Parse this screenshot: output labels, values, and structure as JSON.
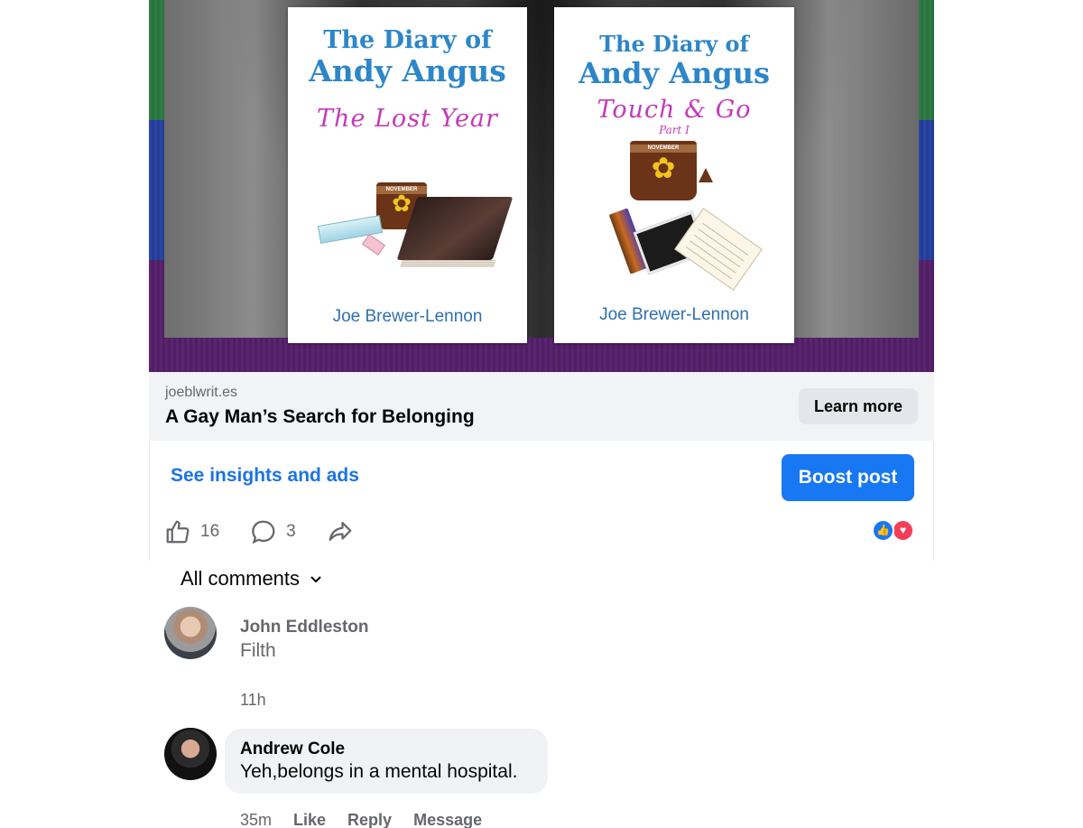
{
  "ad": {
    "books": [
      {
        "title_line1": "The Diary of",
        "title_line2": "Andy Angus",
        "subtitle": "The Lost Year",
        "part": "",
        "author": "Joe Brewer-Lennon"
      },
      {
        "title_line1": "The Diary of",
        "title_line2": "Andy Angus",
        "subtitle": "Touch & Go",
        "part": "Part I",
        "author": "Joe Brewer-Lennon"
      }
    ]
  },
  "link": {
    "domain": "joeblwrit.es",
    "title": "A Gay Man’s Search for Belonging",
    "learn_more_label": "Learn more"
  },
  "post": {
    "insights_label": "See insights and ads",
    "boost_label": "Boost post",
    "like_count": "16",
    "comment_count": "3",
    "reactions": [
      "like-reaction-icon",
      "love-reaction-icon"
    ],
    "colors": {
      "accent": "#1877f2",
      "link": "#1b74e4",
      "love": "#f33e58"
    }
  },
  "comments": {
    "filter_label": "All comments",
    "items": [
      {
        "author": "John Eddleston",
        "text": "Filth",
        "time": "11h"
      },
      {
        "author": "Andrew Cole",
        "text": "Yeh,belongs in a mental hospital.",
        "time": "35m",
        "actions": [
          "Like",
          "Reply",
          "Message"
        ]
      }
    ]
  }
}
